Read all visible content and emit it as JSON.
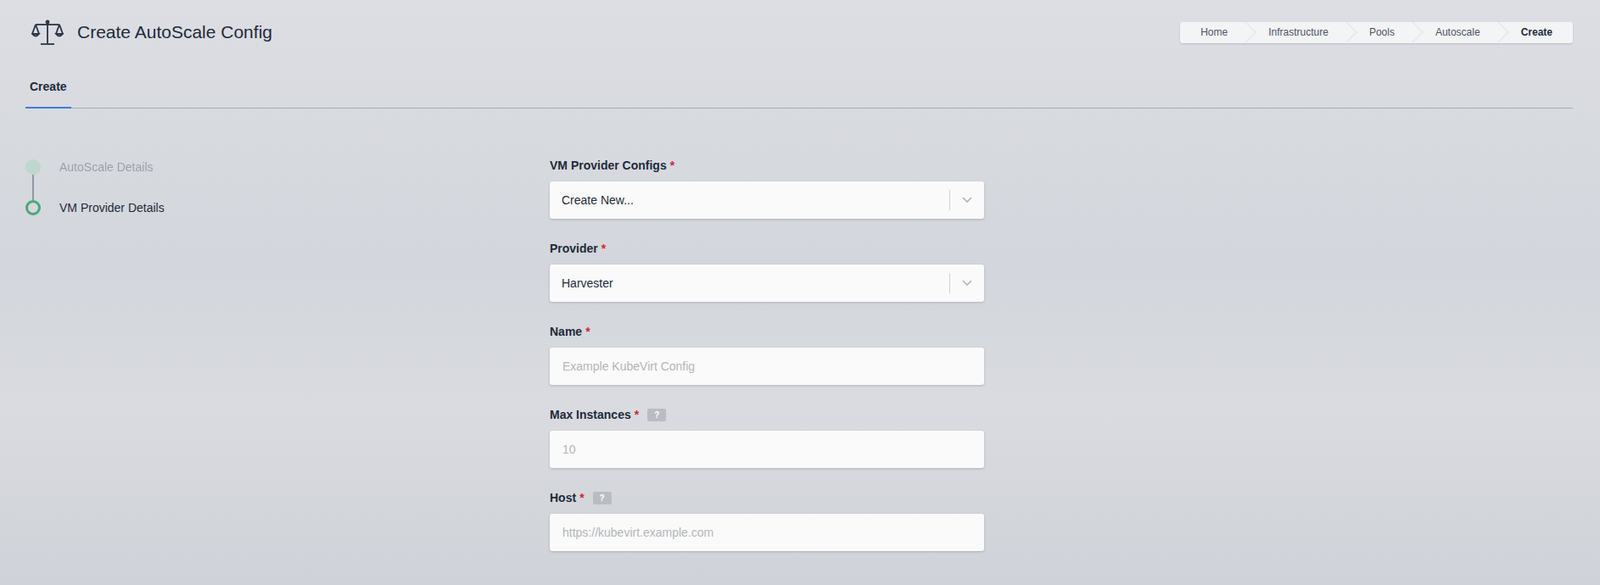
{
  "header": {
    "title": "Create AutoScale Config"
  },
  "breadcrumbs": [
    {
      "label": "Home",
      "selected": false
    },
    {
      "label": "Infrastructure",
      "selected": false
    },
    {
      "label": "Pools",
      "selected": false
    },
    {
      "label": "Autoscale",
      "selected": false
    },
    {
      "label": "Create",
      "selected": true
    }
  ],
  "tabs": [
    {
      "label": "Create",
      "selected": true
    }
  ],
  "steps": [
    {
      "label": "AutoScale Details",
      "done": true,
      "selected": false
    },
    {
      "label": "VM Provider Details",
      "done": false,
      "selected": true
    }
  ],
  "required_mark": "*",
  "help_mark": "?",
  "fields": [
    {
      "kind": "select",
      "label": "VM Provider Configs",
      "required": true,
      "help": false,
      "value": "Create New...",
      "placeholder": ""
    },
    {
      "kind": "select",
      "label": "Provider",
      "required": true,
      "help": false,
      "value": "Harvester",
      "placeholder": ""
    },
    {
      "kind": "input",
      "label": "Name",
      "required": true,
      "help": false,
      "value": "",
      "placeholder": "Example KubeVirt Config"
    },
    {
      "kind": "input",
      "label": "Max Instances",
      "required": true,
      "help": true,
      "value": "",
      "placeholder": "10"
    },
    {
      "kind": "input",
      "label": "Host",
      "required": true,
      "help": true,
      "value": "",
      "placeholder": "https://kubevirt.example.com"
    }
  ]
}
